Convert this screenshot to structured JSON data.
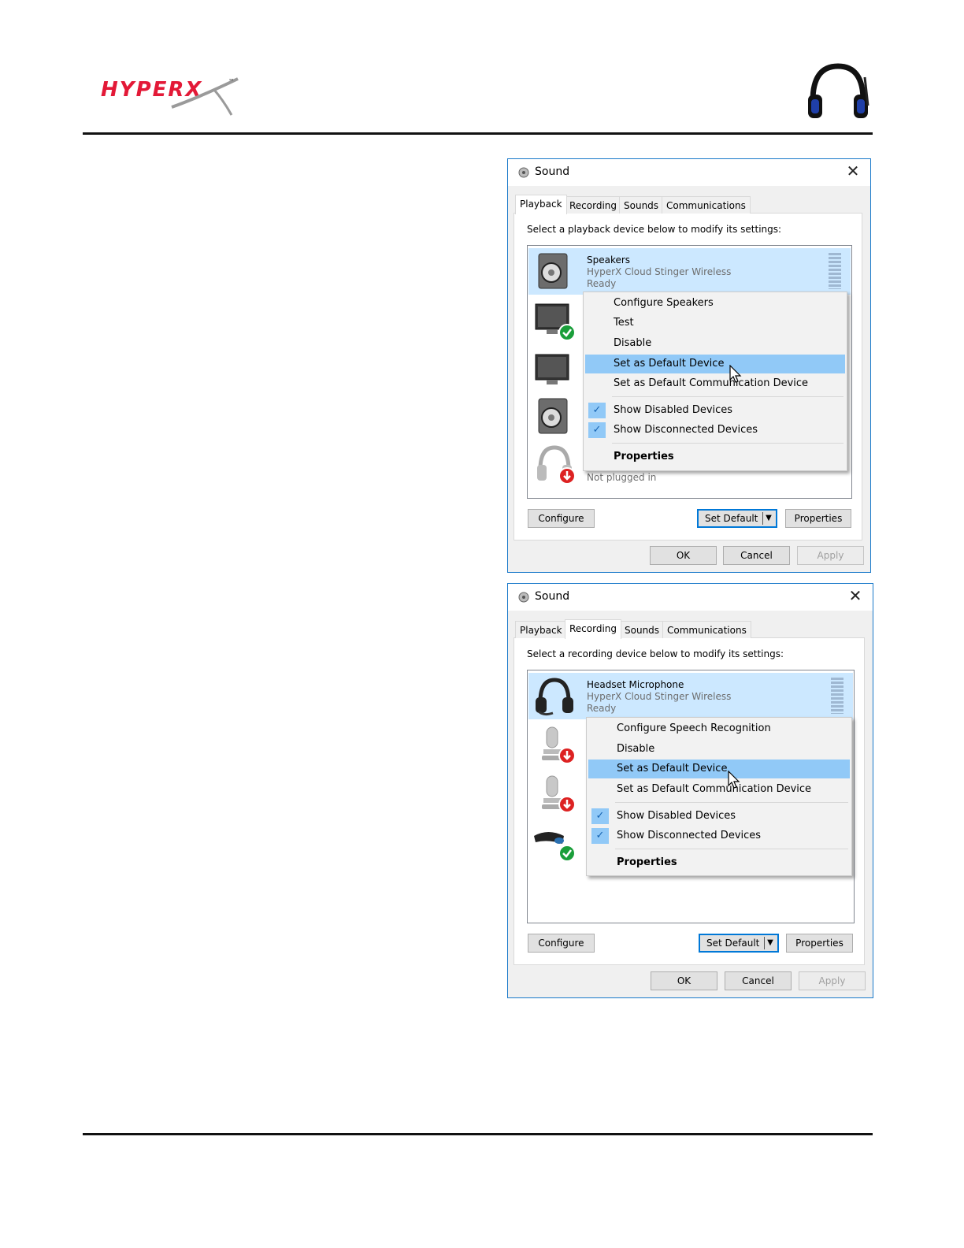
{
  "colors": {
    "brand_red": "#e31937",
    "selection": "#cce8ff",
    "menu_highlight": "#91c9f7",
    "window_border": "#1979ca"
  },
  "logo": {
    "text": "HYPERX",
    "trademark": "™"
  },
  "dialogs": [
    {
      "title": "Sound",
      "close_label": "✕",
      "tabs": [
        "Playback",
        "Recording",
        "Sounds",
        "Communications"
      ],
      "active_tab": "Playback",
      "instruction": "Select a playback device below to modify its settings:",
      "selected_device": {
        "name": "Speakers",
        "description": "HyperX Cloud Stinger Wireless",
        "status": "Ready"
      },
      "other_devices": [
        {
          "icon": "monitor-default-icon"
        },
        {
          "icon": "monitor-icon"
        },
        {
          "icon": "speaker-icon"
        },
        {
          "icon": "headphones-unplugged-icon",
          "status": "Not plugged in"
        }
      ],
      "context_menu": [
        {
          "label": "Configure Speakers"
        },
        {
          "label": "Test"
        },
        {
          "label": "Disable"
        },
        {
          "label": "Set as Default Device",
          "highlighted": true
        },
        {
          "label": "Set as Default Communication Device"
        },
        {
          "label": "Show Disabled Devices",
          "checked": true
        },
        {
          "label": "Show Disconnected Devices",
          "checked": true
        },
        {
          "label": "Properties",
          "bold": true
        }
      ],
      "buttons": {
        "configure": "Configure",
        "set_default": "Set Default",
        "properties": "Properties",
        "ok": "OK",
        "cancel": "Cancel",
        "apply": "Apply"
      }
    },
    {
      "title": "Sound",
      "close_label": "✕",
      "tabs": [
        "Playback",
        "Recording",
        "Sounds",
        "Communications"
      ],
      "active_tab": "Recording",
      "instruction": "Select a recording device below to modify its settings:",
      "selected_device": {
        "name": "Headset Microphone",
        "description": "HyperX Cloud Stinger Wireless",
        "status": "Ready"
      },
      "other_devices": [
        {
          "icon": "microphone-unplugged-icon"
        },
        {
          "icon": "microphone-unplugged-icon"
        },
        {
          "icon": "webcam-default-icon"
        }
      ],
      "context_menu": [
        {
          "label": "Configure Speech Recognition"
        },
        {
          "label": "Disable"
        },
        {
          "label": "Set as Default Device",
          "highlighted": true
        },
        {
          "label": "Set as Default Communication Device"
        },
        {
          "label": "Show Disabled Devices",
          "checked": true
        },
        {
          "label": "Show Disconnected Devices",
          "checked": true
        },
        {
          "label": "Properties",
          "bold": true
        }
      ],
      "buttons": {
        "configure": "Configure",
        "set_default": "Set Default",
        "properties": "Properties",
        "ok": "OK",
        "cancel": "Cancel",
        "apply": "Apply"
      }
    }
  ]
}
